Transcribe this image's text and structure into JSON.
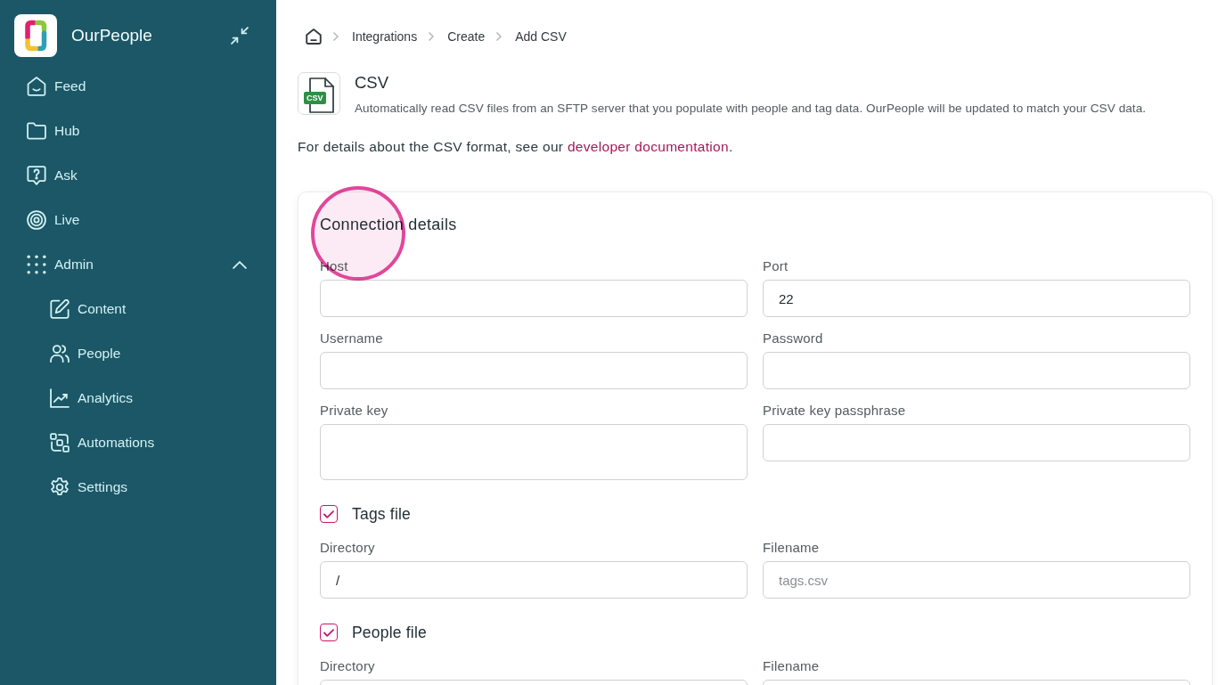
{
  "sidebar": {
    "brand": "OurPeople",
    "items": [
      {
        "label": "Feed",
        "selected": false
      },
      {
        "label": "Hub",
        "selected": false
      },
      {
        "label": "Ask",
        "selected": false
      },
      {
        "label": "Live",
        "selected": false
      },
      {
        "label": "Admin",
        "selected": false,
        "expanded": true,
        "children": [
          {
            "label": "Content",
            "selected": false
          },
          {
            "label": "People",
            "selected": false
          },
          {
            "label": "Analytics",
            "selected": false
          },
          {
            "label": "Automations",
            "selected": false
          },
          {
            "label": "Settings",
            "selected": false
          }
        ]
      }
    ]
  },
  "breadcrumb": [
    {
      "label": "Integrations"
    },
    {
      "label": "Create"
    },
    {
      "label": "Add CSV"
    }
  ],
  "integration": {
    "icon_label": "CSV",
    "title": "CSV",
    "description": "Automatically read CSV files from an SFTP server that you populate with people and tag data. OurPeople will be updated to match your CSV data."
  },
  "intro": {
    "text": "For details about the CSV format, see our ",
    "link": "developer documentation",
    "after": "."
  },
  "connection": {
    "title": "Connection details",
    "fields": [
      {
        "kind": "input",
        "label": "Host"
      },
      {
        "kind": "input",
        "label": "Port",
        "value": "22"
      },
      {
        "kind": "input",
        "label": "Username"
      },
      {
        "kind": "input",
        "label": "Password"
      },
      {
        "kind": "textarea",
        "label": "Private key"
      },
      {
        "kind": "input",
        "label": "Private key passphrase"
      }
    ]
  },
  "files": [
    {
      "title": "Tags file",
      "checked": true,
      "fields": [
        {
          "kind": "input",
          "label": "Directory",
          "value": "/"
        },
        {
          "kind": "input",
          "label": "Filename",
          "placeholder": "tags.csv"
        }
      ]
    },
    {
      "title": "People file",
      "checked": true,
      "fields": [
        {
          "kind": "input",
          "label": "Directory"
        },
        {
          "kind": "input",
          "label": "Filename"
        }
      ]
    }
  ]
}
